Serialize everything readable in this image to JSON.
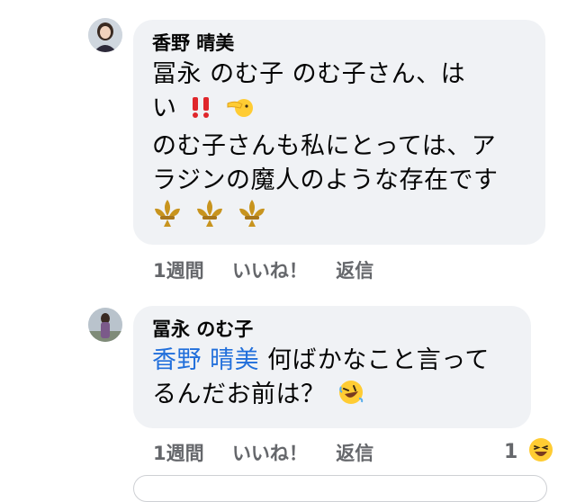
{
  "comments": [
    {
      "author": "香野 晴美",
      "lines": {
        "l1": "冨永 のむ子 のむ子さん、は",
        "l2": "い",
        "l3": "のむ子さんも私にとっては、ア",
        "l4": "ラジンの魔人のような存在です"
      },
      "emojis": [
        "double-exclamation-icon",
        "pointing-hand-icon",
        "fleur-de-lis-icon",
        "fleur-de-lis-icon",
        "fleur-de-lis-icon"
      ],
      "actions": {
        "time": "1週間",
        "like": "いいね！",
        "reply": "返信"
      }
    },
    {
      "author": "冨永 のむ子",
      "mention": "香野 晴美",
      "lines": {
        "l1": " 何ばかなこと言って",
        "l2": "るんだお前は？"
      },
      "emojis": [
        "rolling-laughing-icon"
      ],
      "actions": {
        "time": "1週間",
        "like": "いいね！",
        "reply": "返信"
      },
      "reaction": {
        "count": "1",
        "icon": "laughing-face-icon"
      }
    }
  ],
  "colors": {
    "bubble": "#f0f2f5",
    "action_text": "#65676b",
    "mention": "#216fdb",
    "emoji_gold": "#c8941e",
    "emoji_yellow": "#ffcc33"
  }
}
